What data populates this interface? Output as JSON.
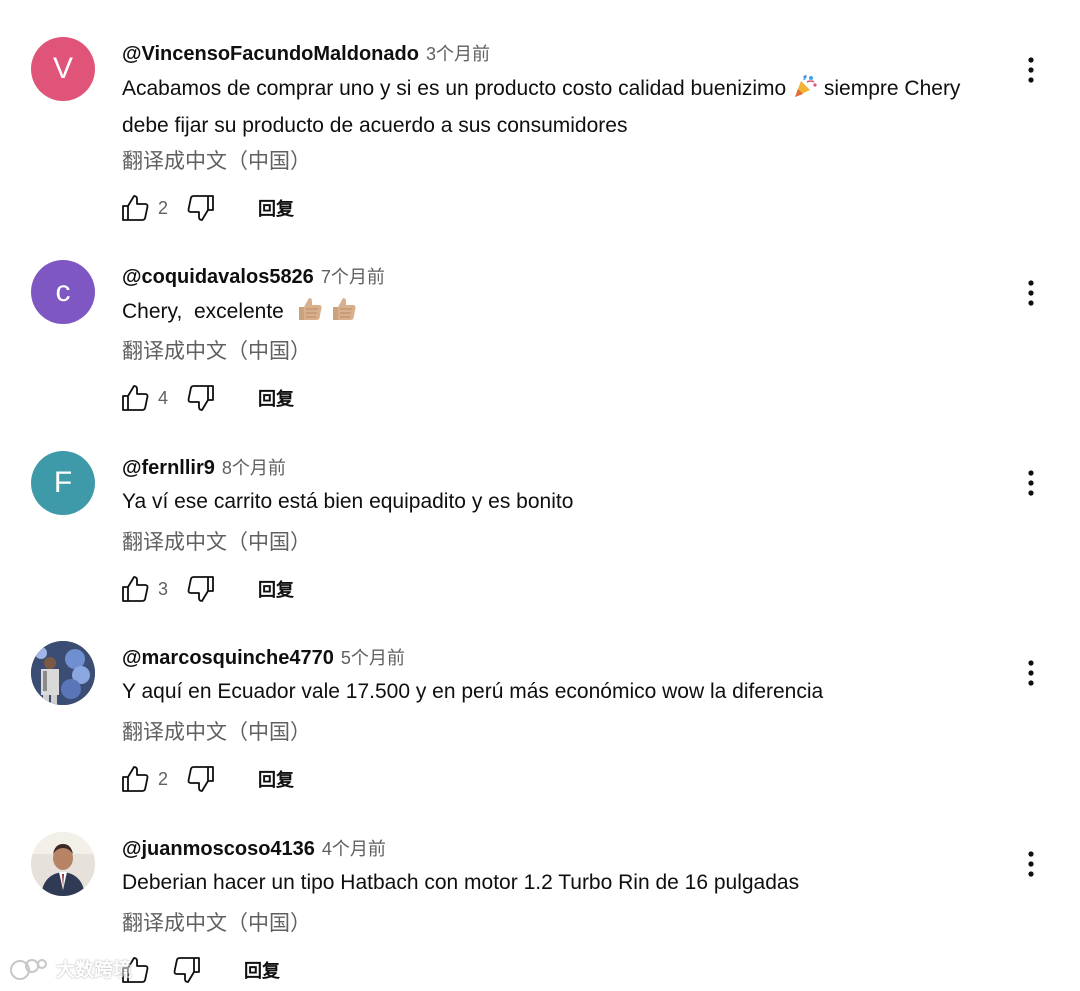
{
  "comments": [
    {
      "avatar_letter": "V",
      "avatar_color": "#e0547a",
      "author": "@VincensoFacundoMaldonado",
      "time": "3个月前",
      "text_before_emoji": "Acabamos de comprar uno y si es un producto costo calidad buenizimo",
      "text_after_emoji": " siempre Chery debe fijar su producto de acuerdo a sus consumidores",
      "emoji": "party-popper-icon",
      "translate": "翻译成中文（中国）",
      "likes": "2",
      "reply": "回复"
    },
    {
      "avatar_letter": "c",
      "avatar_color": "#7e57c2",
      "author": "@coquidavalos5826",
      "time": "7个月前",
      "text": "Chery,  excelente",
      "emoji": "thumbs-up-emoji-icon",
      "translate": "翻译成中文（中国）",
      "likes": "4",
      "reply": "回复"
    },
    {
      "avatar_letter": "F",
      "avatar_color": "#3e9aa8",
      "author": "@fernllir9",
      "time": "8个月前",
      "text": "Ya ví ese carrito está bien equipadito y es bonito",
      "translate": "翻译成中文（中国）",
      "likes": "3",
      "reply": "回复"
    },
    {
      "author": "@marcosquinche4770",
      "time": "5个月前",
      "text": "Y aquí en Ecuador vale 17.500 y en perú más económico wow la diferencia",
      "translate": "翻译成中文（中国）",
      "likes": "2",
      "reply": "回复"
    },
    {
      "author": "@juanmoscoso4136",
      "time": "4个月前",
      "text": "Deberian hacer un tipo Hatbach con motor 1.2 Turbo Rin de 16 pulgadas",
      "translate": "翻译成中文（中国）",
      "reply": "回复"
    }
  ],
  "watermark": {
    "text": "大数跨境",
    "icon": "watermark-logo-icon"
  }
}
